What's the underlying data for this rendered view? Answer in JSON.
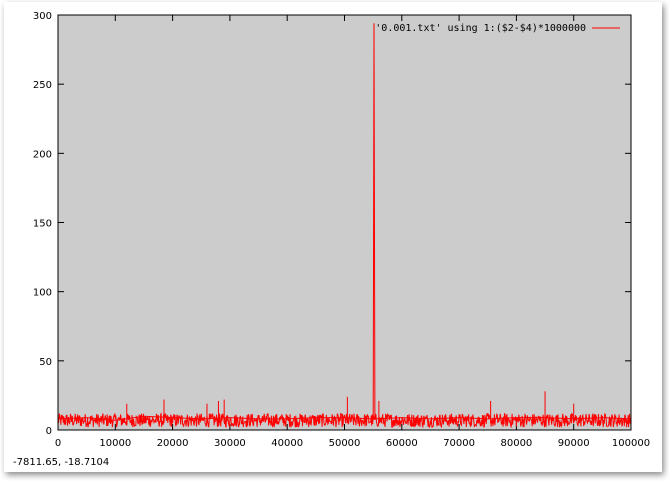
{
  "chart_data": {
    "type": "line",
    "x": [
      0,
      5000,
      10000,
      15000,
      20000,
      25000,
      30000,
      35000,
      40000,
      45000,
      50000,
      55000,
      55150,
      55300,
      60000,
      65000,
      70000,
      75000,
      80000,
      85000,
      90000,
      95000,
      100000
    ],
    "series": [
      {
        "name": "'0.001.txt' using 1:($2-$4)*1000000",
        "color": "#ff0000",
        "baseline_low": 2,
        "baseline_high": 12,
        "values": [
          8,
          9,
          7,
          10,
          9,
          8,
          9,
          8,
          8,
          9,
          9,
          8,
          294,
          8,
          9,
          8,
          9,
          8,
          9,
          9,
          8,
          9,
          8
        ],
        "spikes": [
          [
            12000,
            19
          ],
          [
            18500,
            22
          ],
          [
            26000,
            19
          ],
          [
            28000,
            21
          ],
          [
            29000,
            22
          ],
          [
            50500,
            24
          ],
          [
            56000,
            21
          ],
          [
            75500,
            21
          ],
          [
            85000,
            28
          ],
          [
            90000,
            19
          ]
        ]
      }
    ],
    "xlim": [
      0,
      100000
    ],
    "ylim": [
      0,
      300
    ],
    "xticks": [
      0,
      10000,
      20000,
      30000,
      40000,
      50000,
      60000,
      70000,
      80000,
      90000,
      100000
    ],
    "yticks": [
      0,
      50,
      100,
      150,
      200,
      250,
      300
    ],
    "xlabel": "",
    "ylabel": "",
    "title": "",
    "grid": false,
    "legend_position": "top-right",
    "background_color": "#cccccc"
  },
  "status_bar": {
    "coordinates": "-7811.65, -18.7104"
  }
}
